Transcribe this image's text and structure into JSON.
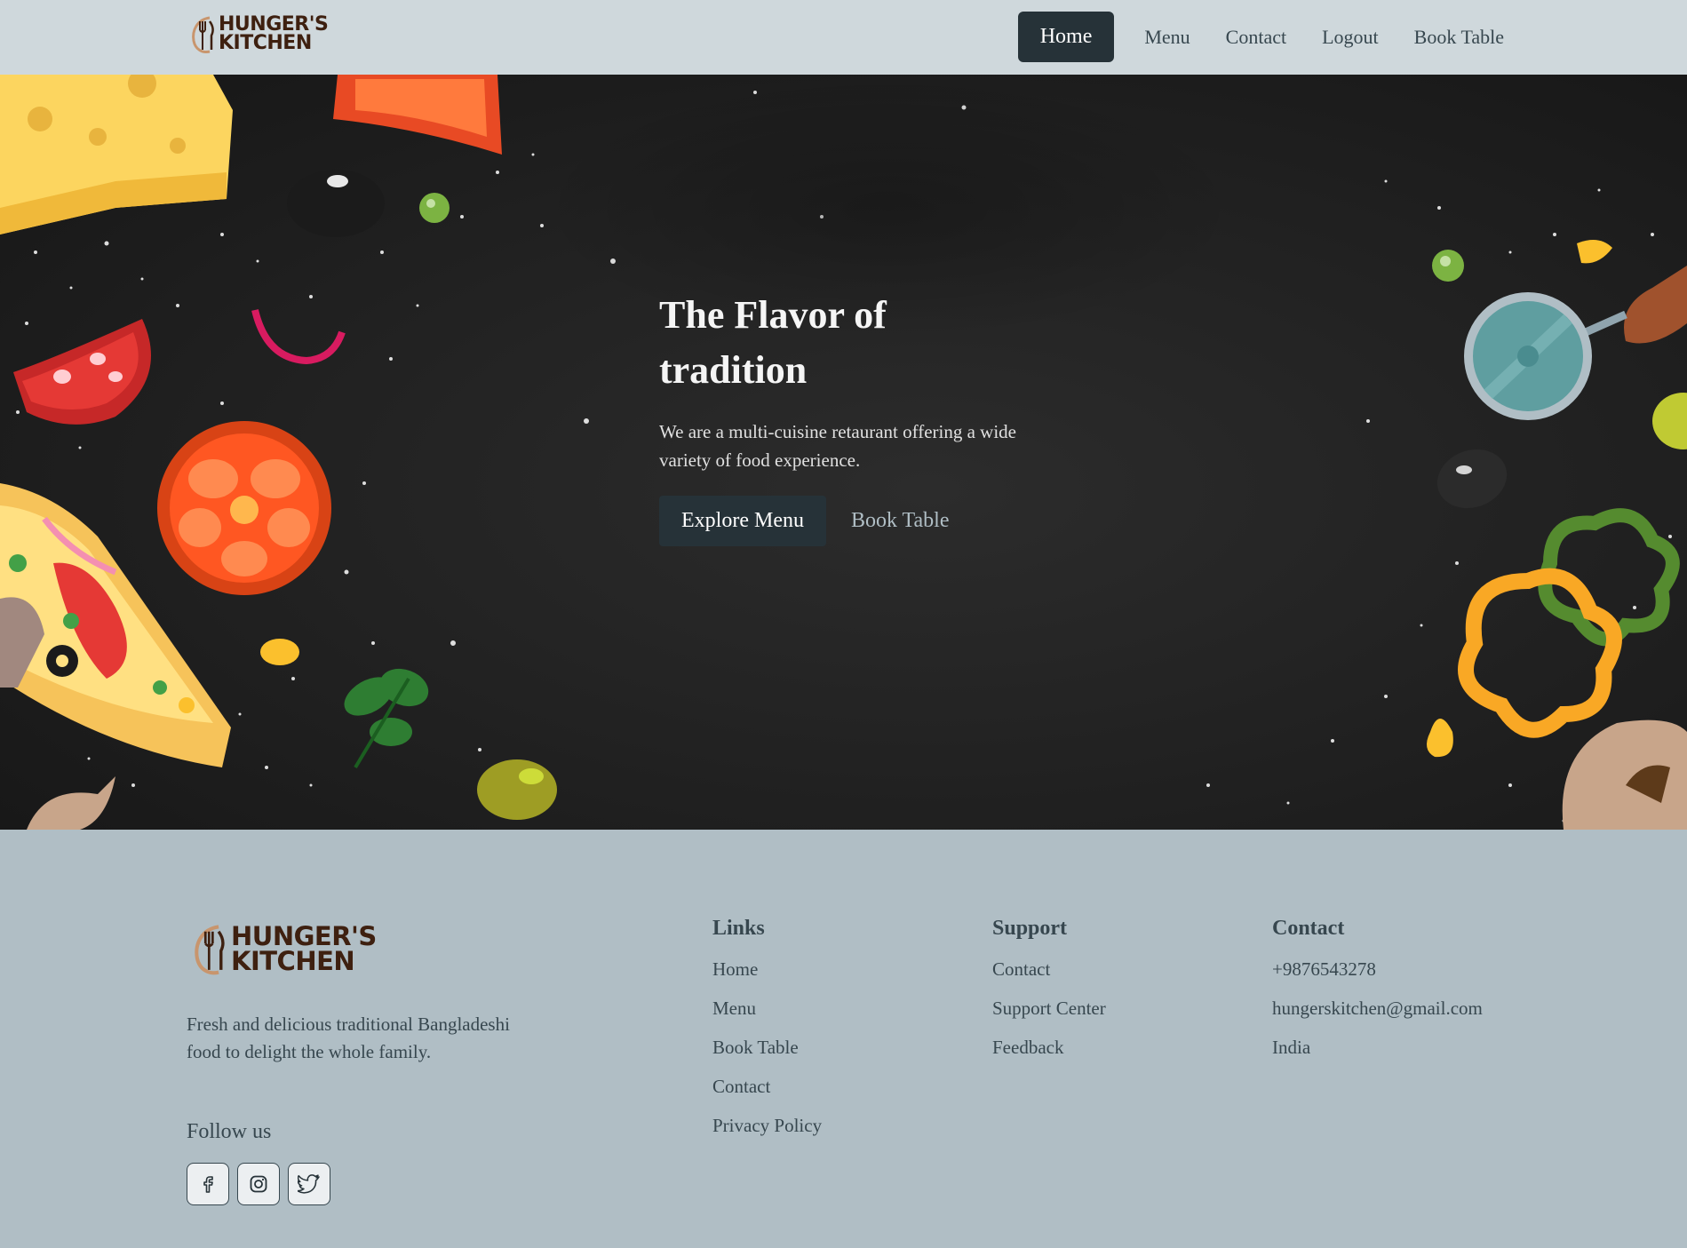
{
  "brand": {
    "line1": "HUNGER'S",
    "line2": "KITCHEN"
  },
  "nav": {
    "items": [
      {
        "label": "Home",
        "active": true
      },
      {
        "label": "Menu",
        "active": false
      },
      {
        "label": "Contact",
        "active": false
      },
      {
        "label": "Logout",
        "active": false
      },
      {
        "label": "Book Table",
        "active": false
      }
    ]
  },
  "hero": {
    "title_line1": "The Flavor of",
    "title_line2": "tradition",
    "description": "We are a multi-cuisine retaurant offering a wide variety of food experience.",
    "primary_button": "Explore Menu",
    "secondary_button": "Book Table"
  },
  "footer": {
    "description": "Fresh and delicious traditional Bangladeshi food to delight the whole family.",
    "follow_title": "Follow us",
    "socials": [
      "facebook-icon",
      "instagram-icon",
      "twitter-icon"
    ],
    "links": {
      "title": "Links",
      "items": [
        "Home",
        "Menu",
        "Book Table",
        "Contact",
        "Privacy Policy"
      ]
    },
    "support": {
      "title": "Support",
      "items": [
        "Contact",
        "Support Center",
        "Feedback"
      ]
    },
    "contact": {
      "title": "Contact",
      "items": [
        "+9876543278",
        "hungerskitchen@gmail.com",
        "India"
      ]
    }
  },
  "colors": {
    "navbar_bg": "#cfd8dc",
    "accent_dark": "#263238",
    "footer_bg": "#b0bec5",
    "hero_bg": "#1f1f1f",
    "brand_brown": "#3e2010"
  }
}
